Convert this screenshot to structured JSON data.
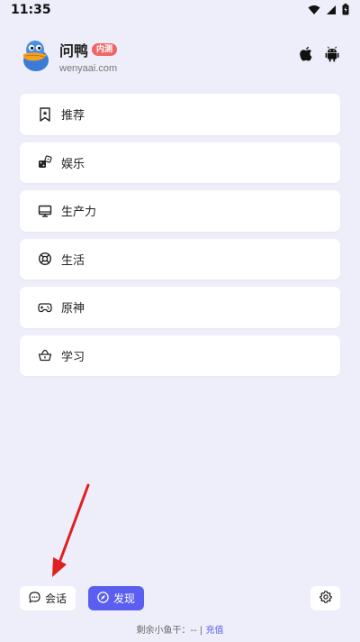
{
  "status_bar": {
    "time": "11:35"
  },
  "header": {
    "app_name": "问鸭",
    "badge": "内测",
    "url": "wenyaai.com"
  },
  "menu": {
    "items": [
      {
        "label": "推荐",
        "icon": "bookmark-star-icon"
      },
      {
        "label": "娱乐",
        "icon": "dice-icon"
      },
      {
        "label": "生产力",
        "icon": "monitor-icon"
      },
      {
        "label": "生活",
        "icon": "lifebuoy-icon"
      },
      {
        "label": "原神",
        "icon": "gamepad-icon"
      },
      {
        "label": "学习",
        "icon": "basket-icon"
      }
    ]
  },
  "bottom_bar": {
    "chat_label": "会话",
    "discover_label": "发现"
  },
  "footer": {
    "remaining_label": "剩余小鱼干：",
    "remaining_value": "--",
    "separator": "|",
    "recharge_label": "充值"
  },
  "colors": {
    "background": "#eeeefa",
    "accent": "#5b5ff0",
    "badge": "#f06666",
    "annotation_arrow": "#e02020"
  }
}
